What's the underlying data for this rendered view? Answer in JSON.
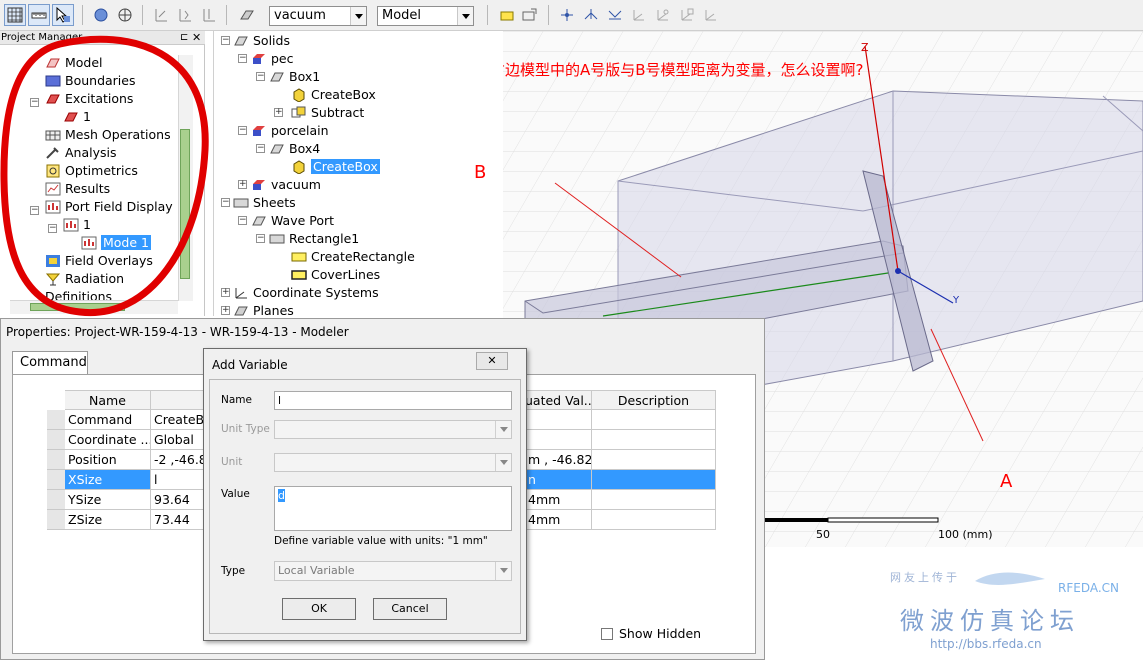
{
  "toolbar": {
    "material_combo": "vacuum",
    "mode_combo": "Model"
  },
  "project_manager": {
    "title": "Project Manager",
    "items": [
      {
        "label": "Model"
      },
      {
        "label": "Boundaries"
      },
      {
        "label": "Excitations"
      },
      {
        "label": "1"
      },
      {
        "label": "Mesh Operations"
      },
      {
        "label": "Analysis"
      },
      {
        "label": "Optimetrics"
      },
      {
        "label": "Results"
      },
      {
        "label": "Port Field Display"
      },
      {
        "label": "1"
      },
      {
        "label": "Mode 1"
      },
      {
        "label": "Field Overlays"
      },
      {
        "label": "Radiation"
      },
      {
        "label": "Definitions"
      }
    ]
  },
  "model_tree": {
    "items": [
      {
        "label": "Solids"
      },
      {
        "label": "pec"
      },
      {
        "label": "Box1"
      },
      {
        "label": "CreateBox"
      },
      {
        "label": "Subtract"
      },
      {
        "label": "porcelain"
      },
      {
        "label": "Box4"
      },
      {
        "label": "CreateBox"
      },
      {
        "label": "vacuum"
      },
      {
        "label": "Sheets"
      },
      {
        "label": "Wave Port"
      },
      {
        "label": "Rectangle1"
      },
      {
        "label": "CreateRectangle"
      },
      {
        "label": "CoverLines"
      },
      {
        "label": "Coordinate Systems"
      },
      {
        "label": "Planes"
      }
    ]
  },
  "viewport": {
    "annotation_question": "我现在想设右边模型中的A号版与B号模型距离为变量，怎么设置啊?",
    "label_b": "B",
    "label_a": "A",
    "axis_z": "Z",
    "axis_y": "Y",
    "scale_50": "50",
    "scale_100": "100 (mm)"
  },
  "properties": {
    "title": "Properties: Project-WR-159-4-13 - WR-159-4-13 - Modeler",
    "tab": "Command",
    "headers": {
      "name": "Name",
      "value": "",
      "evaluated": "uated Val...",
      "description": "Description"
    },
    "rows": [
      {
        "name": "Command",
        "value": "CreateBo",
        "evaluated": ""
      },
      {
        "name": "Coordinate ...",
        "value": "Global",
        "evaluated": ""
      },
      {
        "name": "Position",
        "value": "-2 ,-46.82...",
        "evaluated": "m , -46.82..."
      },
      {
        "name": "XSize",
        "value": "l",
        "evaluated": "n"
      },
      {
        "name": "YSize",
        "value": "93.64",
        "evaluated": "4mm"
      },
      {
        "name": "ZSize",
        "value": "73.44",
        "evaluated": "4mm"
      }
    ],
    "show_hidden": "Show Hidden"
  },
  "dialog": {
    "title": "Add Variable",
    "name_label": "Name",
    "name_value": "l",
    "unit_type_label": "Unit Type",
    "unit_label": "Unit",
    "value_label": "Value",
    "value_value": "d",
    "hint": "Define variable value with units: \"1 mm\"",
    "type_label": "Type",
    "type_value": "Local Variable",
    "ok": "OK",
    "cancel": "Cancel"
  },
  "watermark": {
    "line1": "网友上传于",
    "site": "RFEDA.CN",
    "forum": "微波仿真论坛",
    "url": "http://bbs.rfeda.cn"
  },
  "colors": {
    "annotation": "#ff0000",
    "selection": "#3399ff",
    "scrollbar_thumb": "#a9d08e"
  }
}
